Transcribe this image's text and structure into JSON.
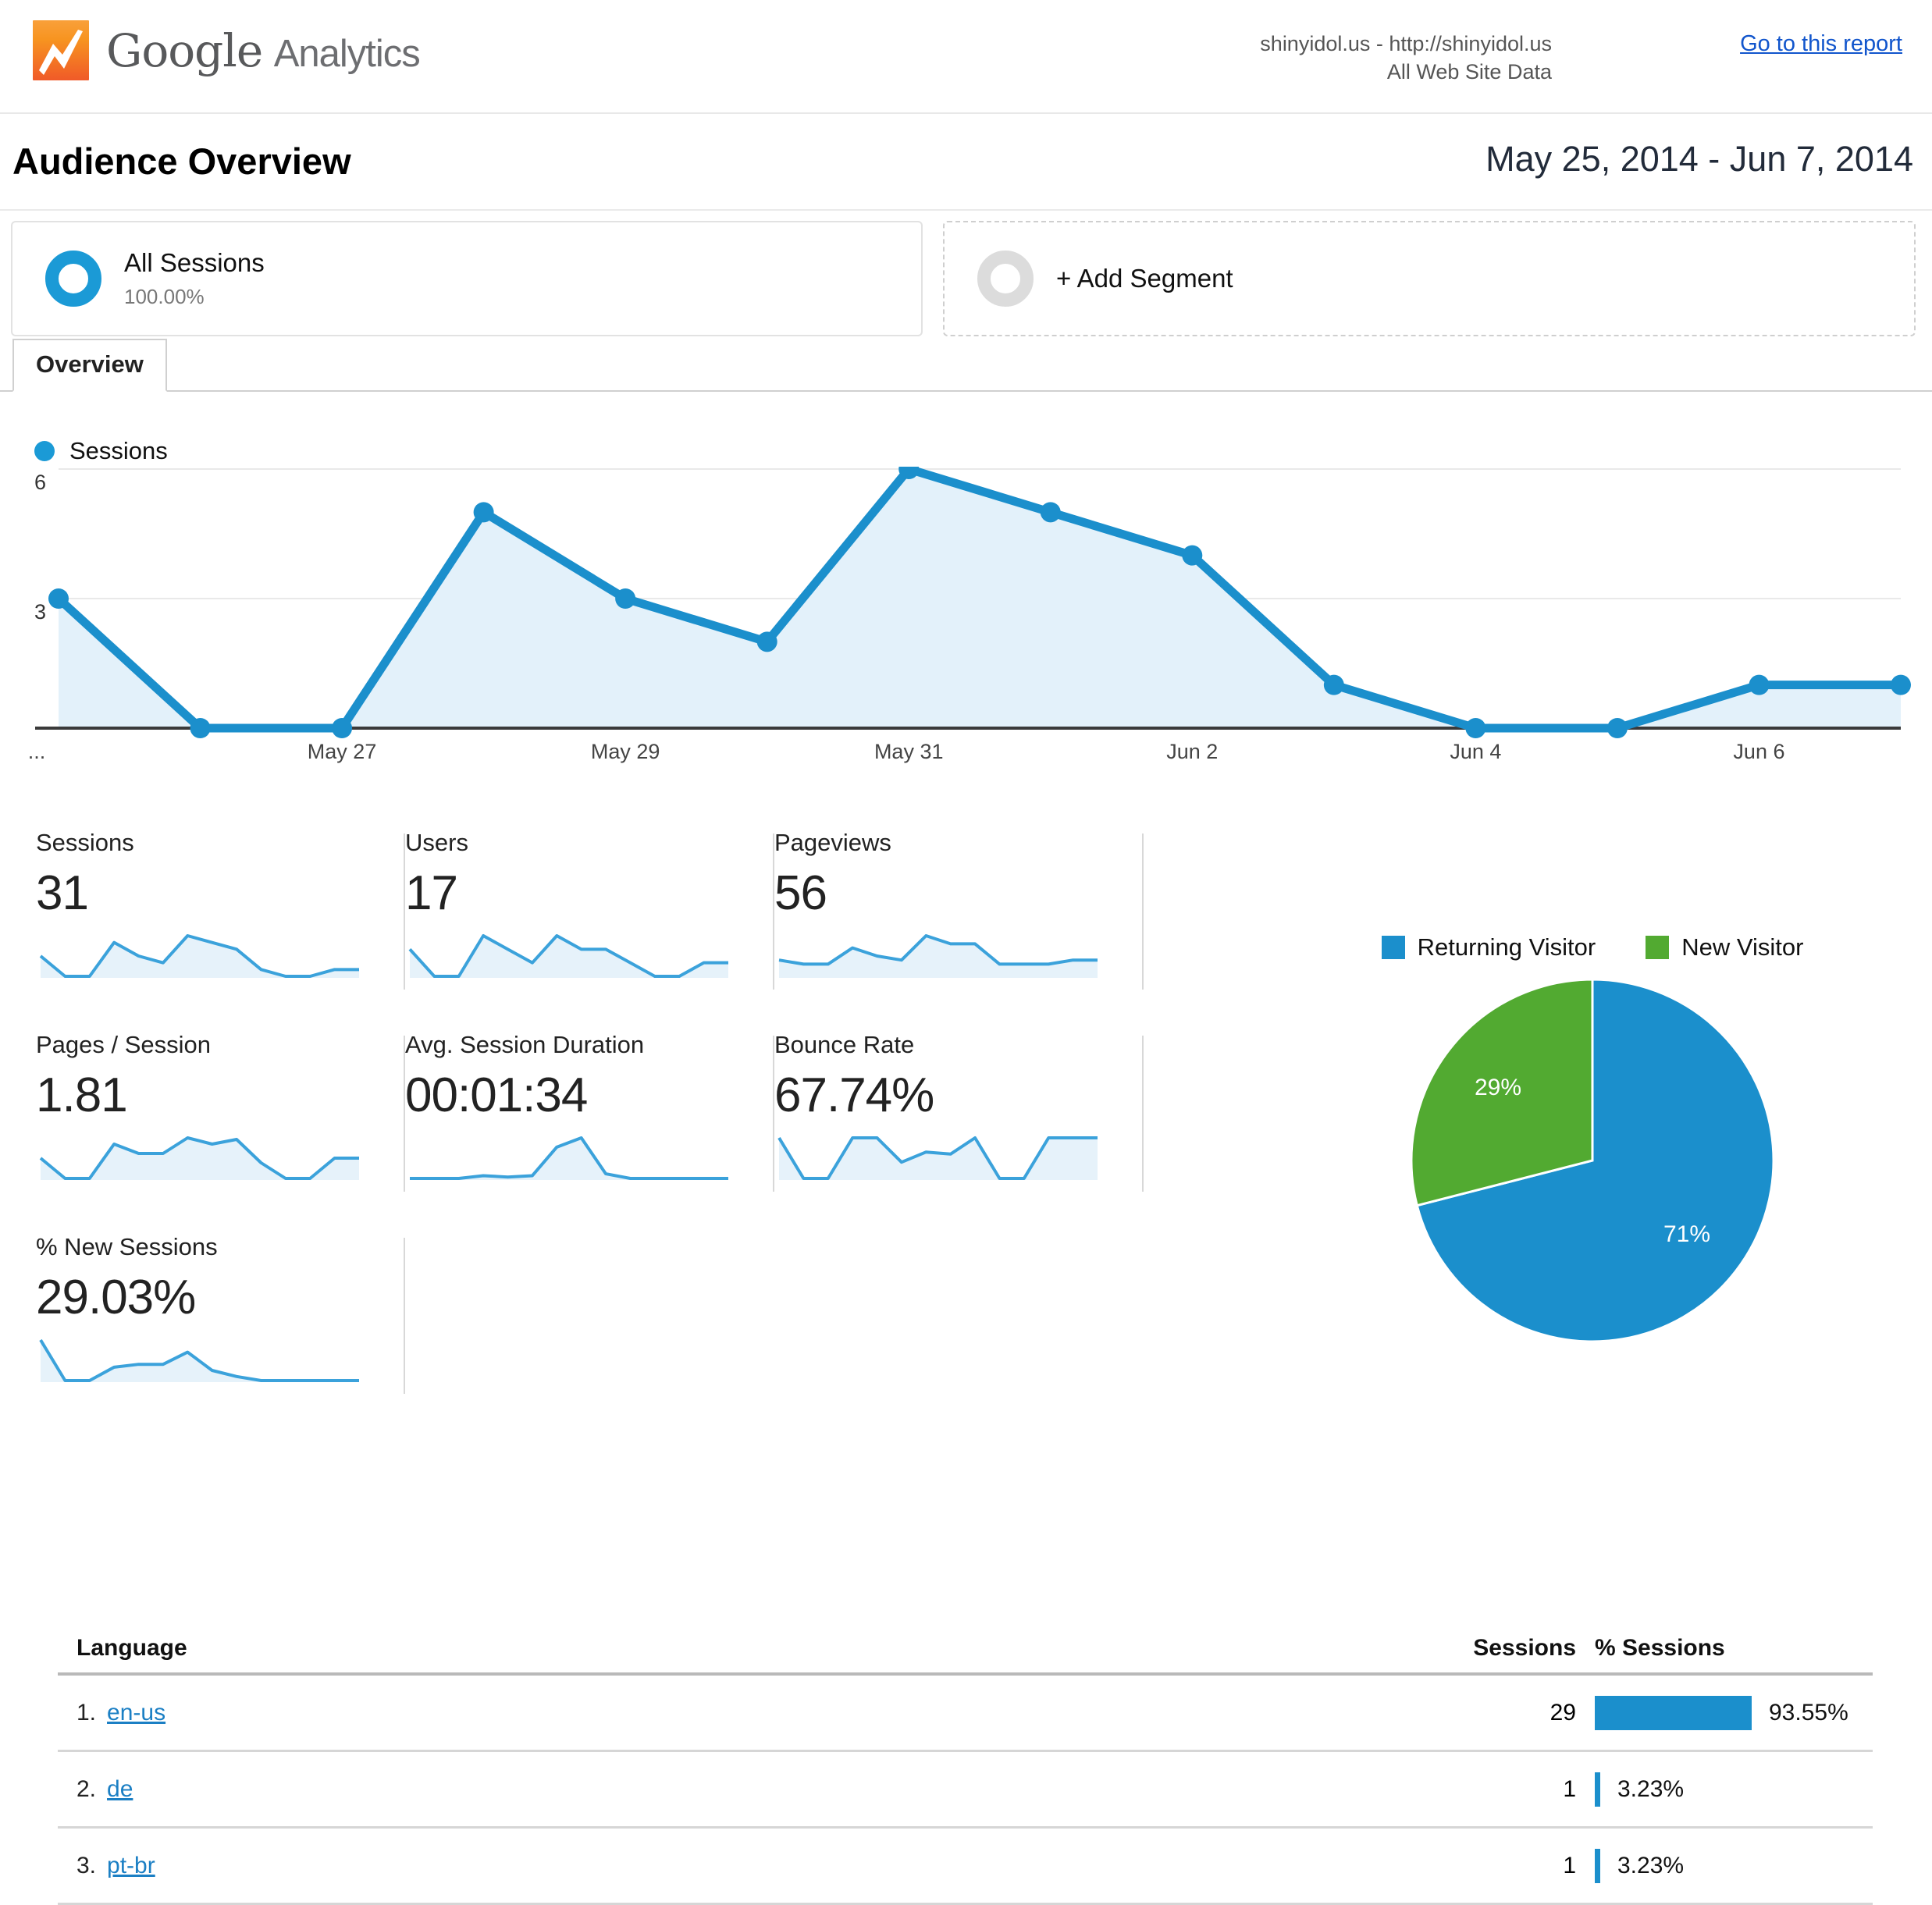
{
  "header": {
    "brand_google": "Google",
    "brand_analytics": "Analytics",
    "site_line1": "shinyidol.us - http://shinyidol.us",
    "site_line2": "All Web Site Data",
    "report_link": "Go to this report"
  },
  "page": {
    "title": "Audience Overview",
    "date_range": "May 25, 2014 - Jun 7, 2014"
  },
  "segments": {
    "all_sessions_label": "All Sessions",
    "all_sessions_pct": "100.00%",
    "add_segment_label": "+ Add Segment"
  },
  "tabs": [
    {
      "label": "Overview"
    }
  ],
  "chart_data": {
    "type": "area",
    "title": "",
    "legend": [
      "Sessions"
    ],
    "legend_position": "top-left",
    "xlabel": "",
    "ylabel": "",
    "ylim": [
      0,
      6
    ],
    "yticks": [
      "3",
      "6"
    ],
    "grid": true,
    "x": [
      "May 25",
      "May 26",
      "May 27",
      "May 28",
      "May 29",
      "May 30",
      "May 31",
      "Jun 1",
      "Jun 2",
      "Jun 3",
      "Jun 4",
      "Jun 5",
      "Jun 6",
      "Jun 7"
    ],
    "xtick_labels": [
      "...",
      "May 27",
      "May 29",
      "May 31",
      "Jun 2",
      "Jun 4",
      "Jun 6"
    ],
    "series": [
      {
        "name": "Sessions",
        "color": "#1b8fcc",
        "values": [
          3,
          0,
          0,
          5,
          3,
          2,
          6,
          5,
          4,
          1,
          0,
          0,
          1,
          1
        ]
      }
    ]
  },
  "metrics": [
    {
      "name": "Sessions",
      "value": "31",
      "spark": [
        3,
        0,
        0,
        5,
        3,
        2,
        6,
        5,
        4,
        1,
        0,
        0,
        1,
        1
      ]
    },
    {
      "name": "Users",
      "value": "17",
      "spark": [
        2,
        0,
        0,
        3,
        2,
        1,
        3,
        2,
        2,
        1,
        0,
        0,
        1,
        1
      ]
    },
    {
      "name": "Pageviews",
      "value": "56",
      "spark": [
        4,
        3,
        3,
        7,
        5,
        4,
        10,
        8,
        8,
        3,
        3,
        3,
        4,
        4
      ]
    },
    {
      "name": "Pages / Session",
      "value": "1.81",
      "spark": [
        1.3,
        0,
        0,
        2.2,
        1.6,
        1.6,
        2.6,
        2.2,
        2.5,
        1.0,
        0,
        0,
        1.3,
        1.3
      ]
    },
    {
      "name": "Avg. Session Duration",
      "value": "00:01:34",
      "spark": [
        0,
        0,
        0,
        0.3,
        0.15,
        0.3,
        3.4,
        4.4,
        0.5,
        0,
        0,
        0,
        0,
        0
      ]
    },
    {
      "name": "Bounce Rate",
      "value": "67.74%",
      "spark": [
        100,
        0,
        0,
        100,
        100,
        40,
        65,
        60,
        100,
        0,
        0,
        100,
        100,
        100
      ]
    },
    {
      "name": "% New Sessions",
      "value": "29.03%",
      "spark": [
        100,
        0,
        0,
        33,
        40,
        40,
        70,
        25,
        10,
        0,
        0,
        0,
        0,
        0
      ]
    }
  ],
  "visitor_pie": {
    "type": "pie",
    "title": "",
    "legend_position": "top",
    "slices": [
      {
        "label": "Returning Visitor",
        "value": 71,
        "display": "71%",
        "color": "#1b8fcc"
      },
      {
        "label": "New Visitor",
        "value": 29,
        "display": "29%",
        "color": "#52aa31"
      }
    ]
  },
  "language_table": {
    "columns": [
      "Language",
      "Sessions",
      "% Sessions"
    ],
    "rows": [
      {
        "rank": "1.",
        "language": "en-us",
        "sessions": "29",
        "pct": "93.55%",
        "bar_pct": 93.55
      },
      {
        "rank": "2.",
        "language": "de",
        "sessions": "1",
        "pct": "3.23%",
        "bar_pct": 3.23
      },
      {
        "rank": "3.",
        "language": "pt-br",
        "sessions": "1",
        "pct": "3.23%",
        "bar_pct": 3.23
      }
    ]
  }
}
